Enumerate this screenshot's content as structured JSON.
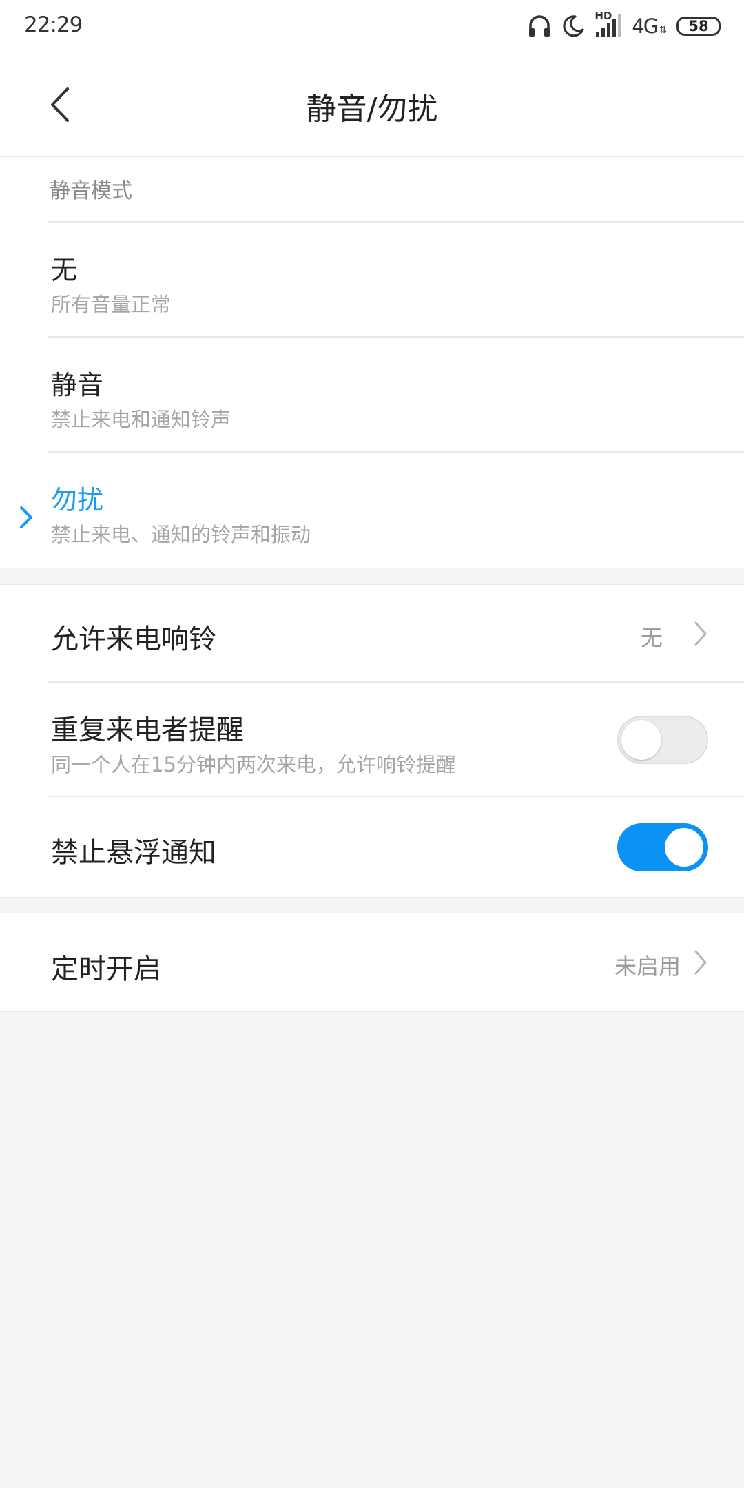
{
  "status_bar": {
    "time": "22:29",
    "hd_label": "HD",
    "network": "4G",
    "network_arrows": "⇅",
    "battery": "58",
    "icons": [
      "headphones-icon",
      "moon-icon",
      "signal-icon",
      "battery-icon"
    ]
  },
  "header": {
    "title": "静音/勿扰",
    "back_icon": "chevron-left-icon"
  },
  "mode_section": {
    "label": "静音模式",
    "options": [
      {
        "title": "无",
        "subtitle": "所有音量正常",
        "selected": false
      },
      {
        "title": "静音",
        "subtitle": "禁止来电和通知铃声",
        "selected": false
      },
      {
        "title": "勿扰",
        "subtitle": "禁止来电、通知的铃声和振动",
        "selected": true
      }
    ]
  },
  "settings": {
    "allow_calls": {
      "title": "允许来电响铃",
      "value": "无"
    },
    "repeat_callers": {
      "title": "重复来电者提醒",
      "subtitle": "同一个人在15分钟内两次来电，允许响铃提醒",
      "enabled": false
    },
    "block_floating": {
      "title": "禁止悬浮通知",
      "enabled": true
    }
  },
  "schedule": {
    "title": "定时开启",
    "value": "未启用"
  },
  "colors": {
    "accent": "#1a9bf0",
    "toggle_on": "#0a93f5",
    "background": "#f5f5f5",
    "secondary_text": "#a5a5a5"
  }
}
